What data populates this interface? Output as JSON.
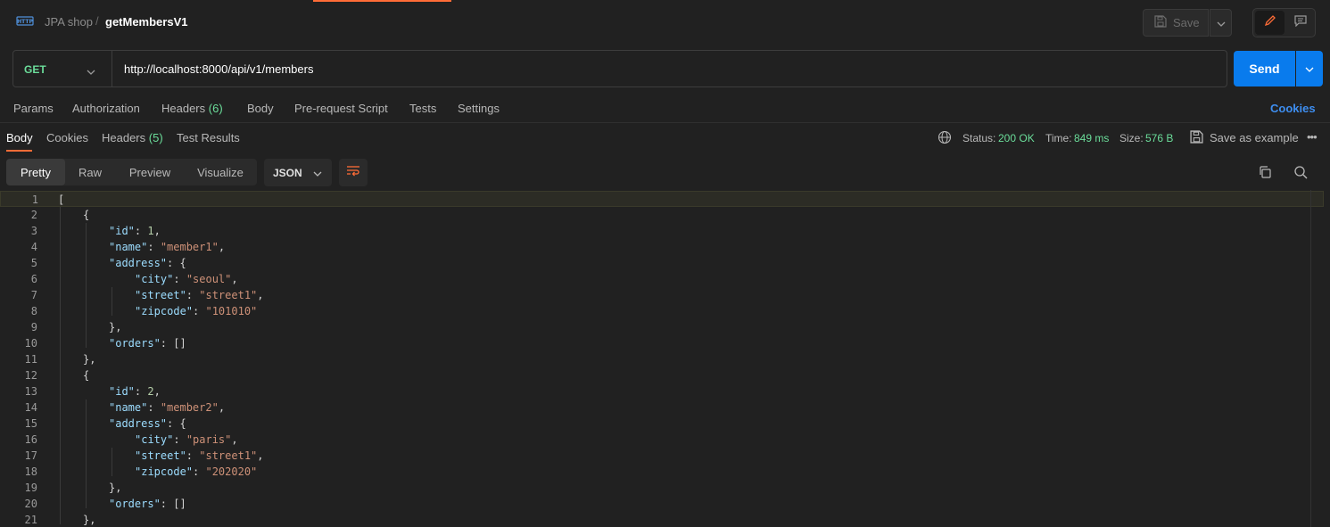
{
  "breadcrumb": {
    "parent": "JPA shop",
    "separator": "/",
    "current": "getMembersV1"
  },
  "toolbar": {
    "save_label": "Save"
  },
  "request": {
    "method": "GET",
    "url": "http://localhost:8000/api/v1/members",
    "send_label": "Send"
  },
  "request_tabs": {
    "params": "Params",
    "authorization": "Authorization",
    "headers": "Headers",
    "headers_count": "(6)",
    "body": "Body",
    "prerequest": "Pre-request Script",
    "tests": "Tests",
    "settings": "Settings",
    "cookies": "Cookies"
  },
  "response_tabs": {
    "body": "Body",
    "cookies": "Cookies",
    "headers": "Headers",
    "headers_count": "(5)",
    "test_results": "Test Results"
  },
  "response_meta": {
    "status_label": "Status:",
    "status_value": "200 OK",
    "time_label": "Time:",
    "time_value": "849 ms",
    "size_label": "Size:",
    "size_value": "576 B",
    "save_example": "Save as example"
  },
  "view": {
    "pretty": "Pretty",
    "raw": "Raw",
    "preview": "Preview",
    "visualize": "Visualize",
    "format": "JSON"
  },
  "colors": {
    "accent": "#ff6c37",
    "send": "#097bed",
    "success": "#6bdd9a",
    "link": "#3e8ef0"
  },
  "code_lines": [
    {
      "num": "1",
      "indent": 0,
      "parts": [
        [
          "p",
          "["
        ]
      ]
    },
    {
      "num": "2",
      "indent": 1,
      "parts": [
        [
          "p",
          "{"
        ]
      ]
    },
    {
      "num": "3",
      "indent": 2,
      "parts": [
        [
          "k",
          "\"id\""
        ],
        [
          "p",
          ": "
        ],
        [
          "n",
          "1"
        ],
        [
          "p",
          ","
        ]
      ]
    },
    {
      "num": "4",
      "indent": 2,
      "parts": [
        [
          "k",
          "\"name\""
        ],
        [
          "p",
          ": "
        ],
        [
          "s",
          "\"member1\""
        ],
        [
          "p",
          ","
        ]
      ]
    },
    {
      "num": "5",
      "indent": 2,
      "parts": [
        [
          "k",
          "\"address\""
        ],
        [
          "p",
          ": {"
        ]
      ]
    },
    {
      "num": "6",
      "indent": 3,
      "parts": [
        [
          "k",
          "\"city\""
        ],
        [
          "p",
          ": "
        ],
        [
          "s",
          "\"seoul\""
        ],
        [
          "p",
          ","
        ]
      ]
    },
    {
      "num": "7",
      "indent": 3,
      "parts": [
        [
          "k",
          "\"street\""
        ],
        [
          "p",
          ": "
        ],
        [
          "s",
          "\"street1\""
        ],
        [
          "p",
          ","
        ]
      ]
    },
    {
      "num": "8",
      "indent": 3,
      "parts": [
        [
          "k",
          "\"zipcode\""
        ],
        [
          "p",
          ": "
        ],
        [
          "s",
          "\"101010\""
        ]
      ]
    },
    {
      "num": "9",
      "indent": 2,
      "parts": [
        [
          "p",
          "},"
        ]
      ]
    },
    {
      "num": "10",
      "indent": 2,
      "parts": [
        [
          "k",
          "\"orders\""
        ],
        [
          "p",
          ": []"
        ]
      ]
    },
    {
      "num": "11",
      "indent": 1,
      "parts": [
        [
          "p",
          "},"
        ]
      ]
    },
    {
      "num": "12",
      "indent": 1,
      "parts": [
        [
          "p",
          "{"
        ]
      ]
    },
    {
      "num": "13",
      "indent": 2,
      "parts": [
        [
          "k",
          "\"id\""
        ],
        [
          "p",
          ": "
        ],
        [
          "n",
          "2"
        ],
        [
          "p",
          ","
        ]
      ]
    },
    {
      "num": "14",
      "indent": 2,
      "parts": [
        [
          "k",
          "\"name\""
        ],
        [
          "p",
          ": "
        ],
        [
          "s",
          "\"member2\""
        ],
        [
          "p",
          ","
        ]
      ]
    },
    {
      "num": "15",
      "indent": 2,
      "parts": [
        [
          "k",
          "\"address\""
        ],
        [
          "p",
          ": {"
        ]
      ]
    },
    {
      "num": "16",
      "indent": 3,
      "parts": [
        [
          "k",
          "\"city\""
        ],
        [
          "p",
          ": "
        ],
        [
          "s",
          "\"paris\""
        ],
        [
          "p",
          ","
        ]
      ]
    },
    {
      "num": "17",
      "indent": 3,
      "parts": [
        [
          "k",
          "\"street\""
        ],
        [
          "p",
          ": "
        ],
        [
          "s",
          "\"street1\""
        ],
        [
          "p",
          ","
        ]
      ]
    },
    {
      "num": "18",
      "indent": 3,
      "parts": [
        [
          "k",
          "\"zipcode\""
        ],
        [
          "p",
          ": "
        ],
        [
          "s",
          "\"202020\""
        ]
      ]
    },
    {
      "num": "19",
      "indent": 2,
      "parts": [
        [
          "p",
          "},"
        ]
      ]
    },
    {
      "num": "20",
      "indent": 2,
      "parts": [
        [
          "k",
          "\"orders\""
        ],
        [
          "p",
          ": []"
        ]
      ]
    },
    {
      "num": "21",
      "indent": 1,
      "parts": [
        [
          "p",
          "},"
        ]
      ]
    }
  ]
}
